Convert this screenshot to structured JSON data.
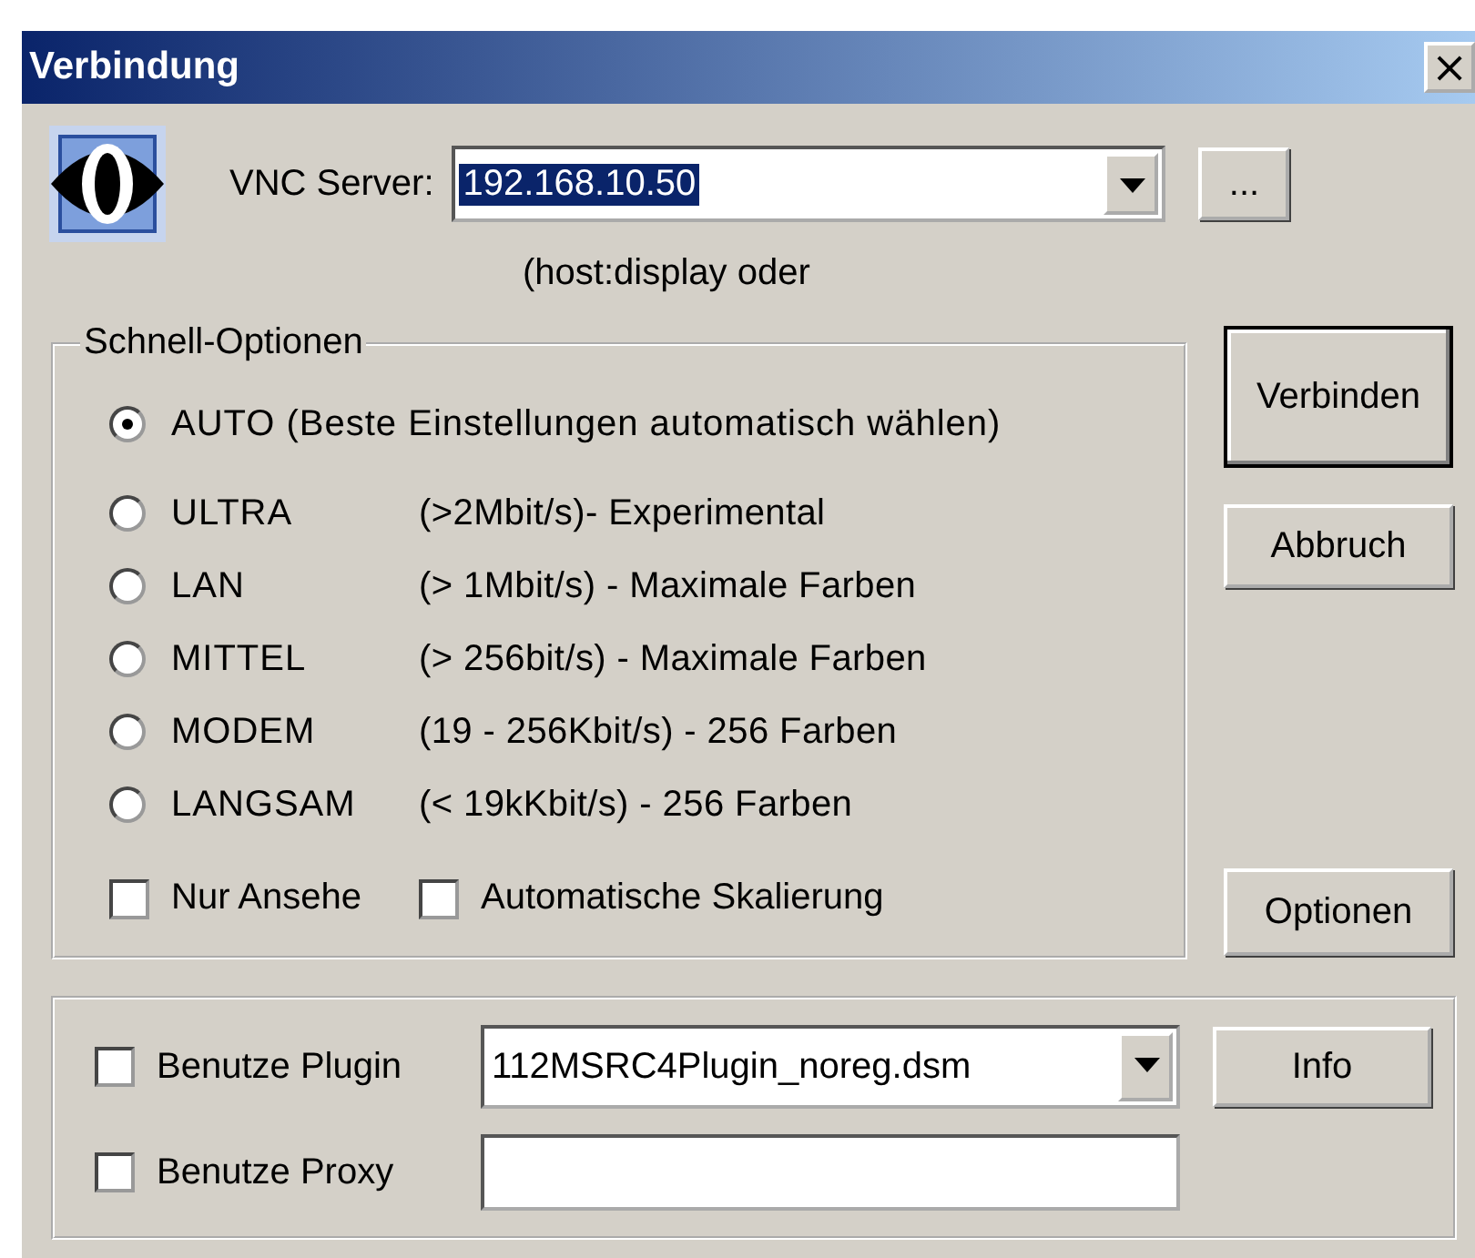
{
  "window": {
    "title": "Verbindung",
    "close": "×"
  },
  "server": {
    "label": "VNC Server:",
    "value": "192.168.10.50",
    "hint": "(host:display oder",
    "browse": "..."
  },
  "quick_options": {
    "title": "Schnell-Optionen",
    "modes": [
      {
        "kind": "summary",
        "name": "AUTO",
        "description": "(Beste Einstellungen automatisch wählen)",
        "selected": true
      },
      {
        "kind": "preset",
        "name": "ULTRA",
        "description": "(>2Mbit/s)- Experimental",
        "selected": false
      },
      {
        "kind": "preset",
        "name": "LAN",
        "description": "(> 1Mbit/s) - Maximale Farben",
        "selected": false
      },
      {
        "kind": "preset",
        "name": "MITTEL",
        "description": "(> 256bit/s) - Maximale Farben",
        "selected": false
      },
      {
        "kind": "preset",
        "name": "MODEM",
        "description": "(19 - 256Kbit/s) - 256 Farben",
        "selected": false
      },
      {
        "kind": "preset",
        "name": "LANGSAM",
        "description": "(< 19kKbit/s) - 256 Farben",
        "selected": false
      }
    ],
    "checkboxes": [
      {
        "label": "Nur Ansehe",
        "checked": false
      },
      {
        "label": "Automatische Skalierung",
        "checked": false
      }
    ]
  },
  "buttons": [
    {
      "label": "Verbinden",
      "default": true
    },
    {
      "label": "Abbruch",
      "default": false
    },
    {
      "label": "Optionen",
      "default": false
    }
  ],
  "plugin": {
    "label": "Benutze Plugin",
    "checked": false,
    "value": "112MSRC4Plugin_noreg.dsm",
    "button": "Info"
  },
  "proxy": {
    "label": "Benutze Proxy",
    "checked": false
  }
}
